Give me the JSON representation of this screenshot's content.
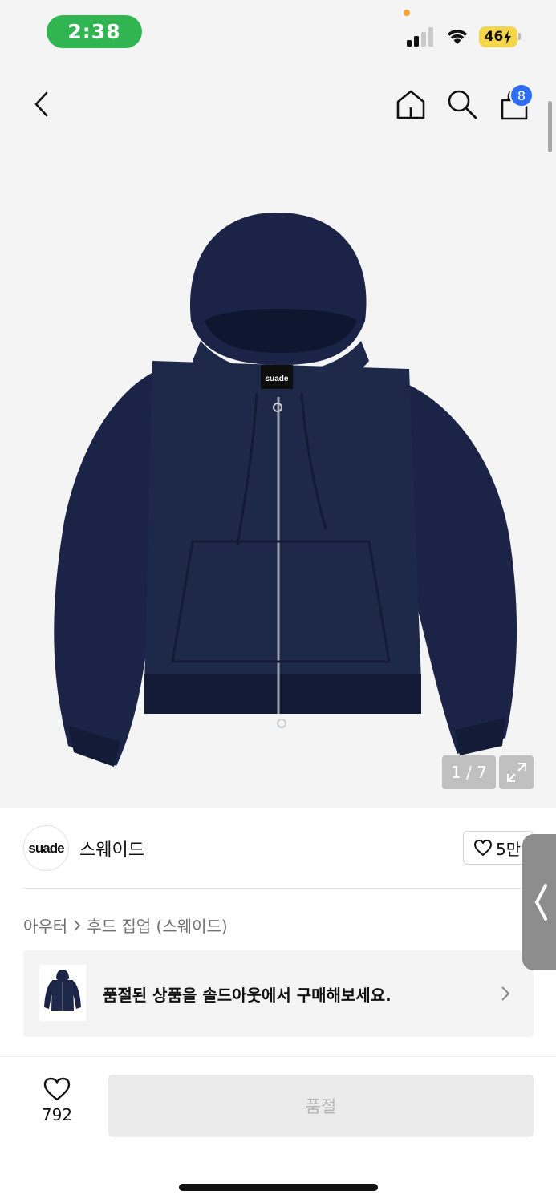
{
  "status_bar": {
    "time": "2:38",
    "battery": "46",
    "icons": [
      "signal-icon",
      "wifi-icon",
      "battery-charging-icon"
    ]
  },
  "nav": {
    "icons": [
      "back-icon",
      "home-icon",
      "search-icon",
      "cart-icon"
    ],
    "cart_count": "8"
  },
  "gallery": {
    "counter": "1 / 7",
    "image_alt": "navy zip-up hoodie",
    "logo_on_product": "suade"
  },
  "brand": {
    "logo_text": "suade",
    "name": "스웨이드",
    "likes": "5만"
  },
  "breadcrumb": {
    "items": [
      "아우터",
      "후드 집업 (스웨이드)"
    ]
  },
  "banner": {
    "text": "품절된 상품을 솔드아웃에서 구매해보세요."
  },
  "bottom_bar": {
    "wish_count": "792",
    "action_label": "품절"
  },
  "colors": {
    "hero_bg": "#f4f4f4",
    "status_green": "#30b551",
    "battery_yellow": "#f3d64a",
    "badge_blue": "#2f6df2",
    "hoodie_navy": "#1b2446",
    "disabled_gray": "#ebebeb"
  }
}
